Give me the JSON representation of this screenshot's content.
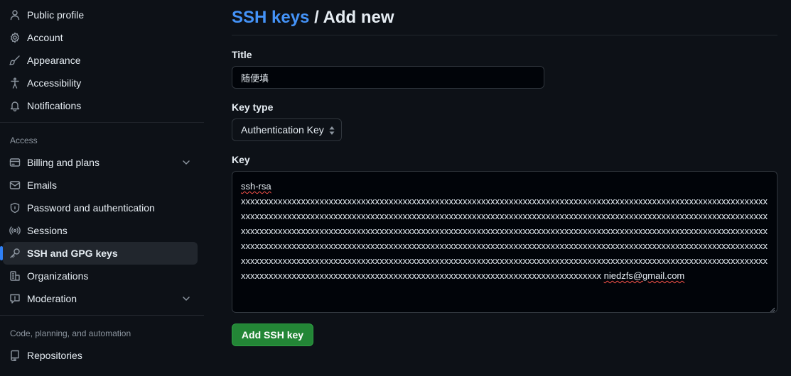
{
  "sidebar": {
    "items_top": [
      {
        "label": "Public profile",
        "icon": "person-icon"
      },
      {
        "label": "Account",
        "icon": "gear-icon"
      },
      {
        "label": "Appearance",
        "icon": "paintbrush-icon"
      },
      {
        "label": "Accessibility",
        "icon": "accessibility-icon"
      },
      {
        "label": "Notifications",
        "icon": "bell-icon"
      }
    ],
    "access_heading": "Access",
    "items_access": [
      {
        "label": "Billing and plans",
        "icon": "credit-card-icon",
        "expandable": true
      },
      {
        "label": "Emails",
        "icon": "mail-icon"
      },
      {
        "label": "Password and authentication",
        "icon": "shield-lock-icon"
      },
      {
        "label": "Sessions",
        "icon": "broadcast-icon"
      },
      {
        "label": "SSH and GPG keys",
        "icon": "key-icon",
        "active": true
      },
      {
        "label": "Organizations",
        "icon": "organization-icon"
      },
      {
        "label": "Moderation",
        "icon": "report-icon",
        "expandable": true
      }
    ],
    "code_heading": "Code, planning, and automation",
    "items_code": [
      {
        "label": "Repositories",
        "icon": "repo-icon"
      }
    ]
  },
  "main": {
    "breadcrumb_link": "SSH keys",
    "breadcrumb_sep": " / ",
    "title": "Add new",
    "title_label": "Title",
    "title_value": "随便填",
    "key_type_label": "Key type",
    "key_type_value": "Authentication Key",
    "key_label": "Key",
    "key_prefix": "ssh-rsa",
    "key_body": "xxxxxxxxxxxxxxxxxxxxxxxxxxxxxxxxxxxxxxxxxxxxxxxxxxxxxxxxxxxxxxxxxxxxxxxxxxxxxxxxxxxxxxxxxxxxxxxxxxxxxxxxxxxxxxxxxxxxxxxxxxxxxxxxxxxxxxxxxxxxxxxxxxxxxxxxxxxxxxxxxxxxxxxxxxxxxxxxxxxxxxxxxxxxxxxxxxxxxxxxxxxxxxxxxxxxxxxxxxxxxxxxxxxxxxxxxxxxxxxxxxxxxxxxxxxxxxxxxxxxxxxxxxxxxxxxxxxxxxxxxxxxxxxxxxxxxxxxxxxxxxxxxxxxxxxxxxxxxxxxxxxxxxxxxxxxxxxxxxxxxxxxxxxxxxxxxxxxxxxxxxxxxxxxxxxxxxxxxxxxxxxxxxxxxxxxxxxxxxxxxxxxxxxxxxxxxxxxxxxxxxxxxxxxxxxxxxxxxxxxxxxxxxxxxxxxxxxxxxxxxxxxxxxxxxxxxxxxxxxxxxxxxxxxxxxxxxxxxxxxxxxxxxxxxxxxxxxxxxxxxxxxxxxxxxxxxxxxxxxxxxxxxxxxxxxxxxxxxxxxxxxxxxxxxxxxxxxxxxxxxxxxxxxxxxxxxxxxxxxxxxxxxxxxxxxxxxxxxxxxxxxxxxxxxxxxxxxxxxxxxxxxxxxx",
    "key_email": "niedzfs@gmail.com",
    "submit_label": "Add SSH key"
  },
  "colors": {
    "background": "#0d1117",
    "link": "#4493f8",
    "primary_button": "#238636",
    "active_indicator": "#2f81f7"
  }
}
